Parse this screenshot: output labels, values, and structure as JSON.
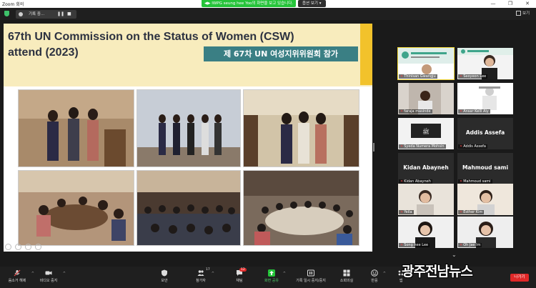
{
  "window": {
    "app_title": "Zoom 회의",
    "controls": [
      "—",
      "❐",
      "✕"
    ]
  },
  "share_banner": {
    "text": "IWPG seung hee Yoo의 화면을 보고 있습니다."
  },
  "view_options": {
    "label": "옵션 보기",
    "caret": "▾"
  },
  "recording": {
    "label": "기록 중...",
    "pause": "❚❚",
    "stop": "■"
  },
  "view_button": {
    "label": "보기"
  },
  "slide": {
    "title_line1": "67th UN Commission on the Status of Women (CSW)",
    "title_line2": "attend (2023)",
    "korean_banner": "제 67차 UN 여성지위위원회 참가",
    "colors": {
      "band": "#f8ecbd",
      "accent": "#f2c22b",
      "banner": "#3a7f84"
    }
  },
  "participants": [
    {
      "name": "Thinisan Gwangju",
      "type": "slide",
      "active": true
    },
    {
      "name": "Seoyeon Lee",
      "type": "slide"
    },
    {
      "name": "faraja masinde",
      "type": "video"
    },
    {
      "name": "Ansar Kelli Aly",
      "type": "video"
    },
    {
      "name": "Syeda Numera Mohsin",
      "type": "video"
    },
    {
      "name": "Addis Assefa",
      "type": "name",
      "display": "Addis Assefa"
    },
    {
      "name": "Kidan Abayneh",
      "type": "name",
      "display": "Kidan Abayneh"
    },
    {
      "name": "Mahmoud sami",
      "type": "name",
      "display": "Mahmoud sami"
    },
    {
      "name": "Yeila",
      "type": "video"
    },
    {
      "name": "Esther Kim",
      "type": "video"
    },
    {
      "name": "Song hee Lee",
      "type": "video"
    },
    {
      "name": "Oh Jae Im",
      "type": "video"
    }
  ],
  "toolbar": {
    "mute": "음소거 해제",
    "video": "비디오 중지",
    "security": "보안",
    "participants": "참가자",
    "participants_count": "17",
    "chat": "채팅",
    "chat_badge": "12",
    "share": "화면 공유",
    "record": "기록 일시 중지/중지",
    "breakout": "소회의실",
    "reactions": "반응",
    "more": "앱",
    "leave": "나가기"
  },
  "watermark": {
    "text": "광주전남뉴스"
  }
}
